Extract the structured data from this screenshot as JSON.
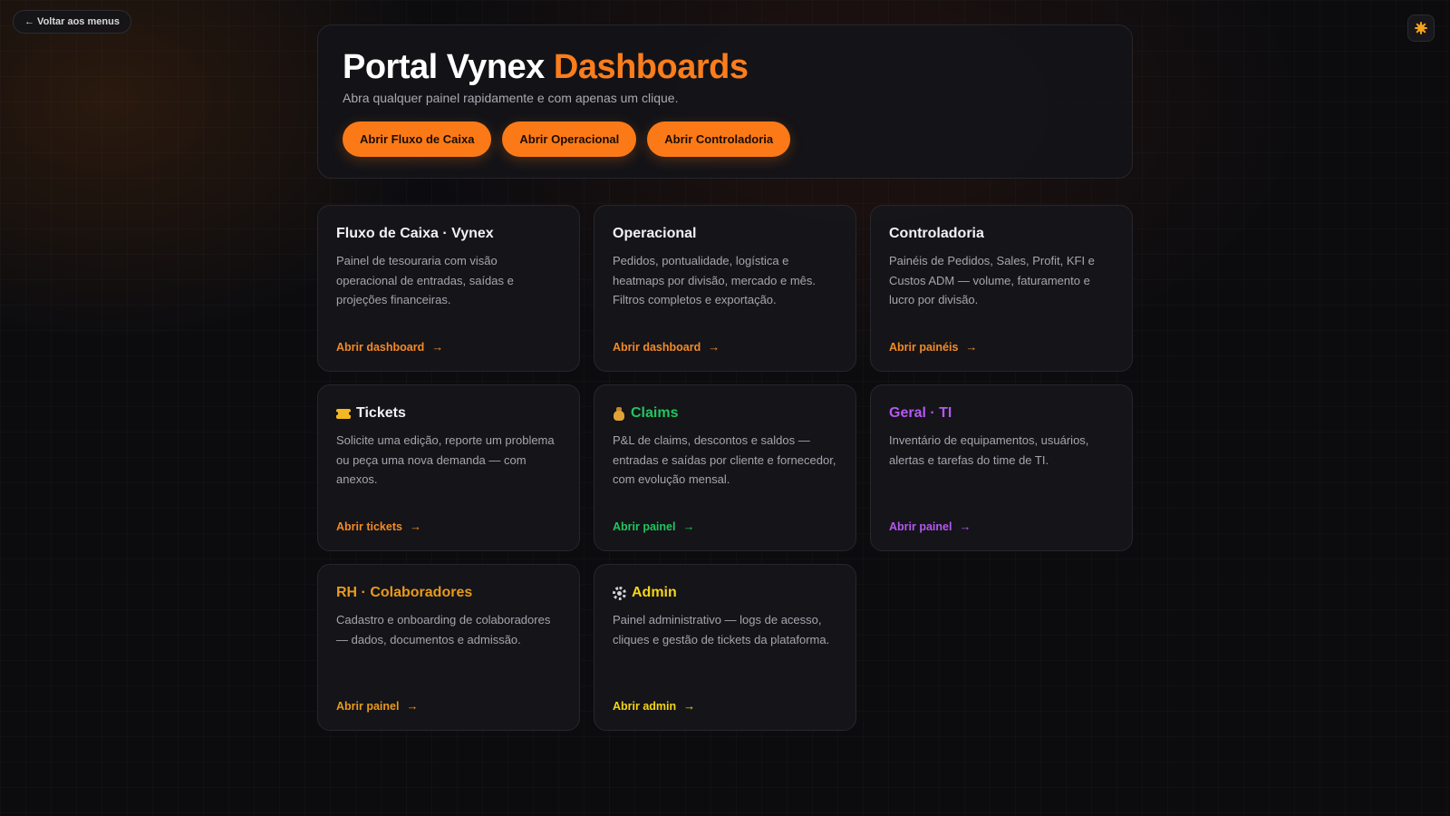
{
  "topbar": {
    "back_label": "← Voltar aos menus"
  },
  "theme_toggle": {
    "icon": "sun-icon"
  },
  "hero": {
    "title_main": "Portal Vynex",
    "title_accent": "Dashboards",
    "subtitle": "Abra qualquer painel rapidamente e com apenas um clique.",
    "actions": [
      {
        "label": "Abrir Fluxo de Caixa"
      },
      {
        "label": "Abrir Operacional"
      },
      {
        "label": "Abrir Controladoria"
      }
    ]
  },
  "colors": {
    "accent": "#fb7a17",
    "green": "#22c55e",
    "purple": "#b558f0",
    "amber": "#e99a1a",
    "yellow": "#f5d516"
  },
  "cards": [
    {
      "title": "Fluxo de Caixa · Vynex",
      "description": "Painel de tesouraria com visão operacional de entradas, saídas e projeções financeiras.",
      "link": "Abrir dashboard"
    },
    {
      "title": "Operacional",
      "description": "Pedidos, pontualidade, logística e heatmaps por divisão, mercado e mês. Filtros completos e exportação.",
      "link": "Abrir dashboard"
    },
    {
      "title": "Controladoria",
      "description": "Painéis de Pedidos, Sales, Profit, KFI e Custos ADM — volume, faturamento e lucro por divisão.",
      "link": "Abrir painéis"
    },
    {
      "icon": "ticket-icon",
      "title": "Tickets",
      "description": "Solicite uma edição, reporte um problema ou peça uma nova demanda — com anexos.",
      "link": "Abrir tickets"
    },
    {
      "icon": "money-bag-icon",
      "title": "Claims",
      "description": "P&L de claims, descontos e saldos — entradas e saídas por cliente e fornecedor, com evolução mensal.",
      "link": "Abrir painel"
    },
    {
      "title": "Geral · TI",
      "description": "Inventário de equipamentos, usuários, alertas e tarefas do time de TI.",
      "link": "Abrir painel"
    },
    {
      "title": "RH · Colaboradores",
      "description": "Cadastro e onboarding de colaboradores — dados, documentos e admissão.",
      "link": "Abrir painel"
    },
    {
      "icon": "gear-icon",
      "title": "Admin",
      "description": "Painel administrativo — logs de acesso, cliques e gestão de tickets da plataforma.",
      "link": "Abrir admin"
    }
  ],
  "link_arrow": "→"
}
